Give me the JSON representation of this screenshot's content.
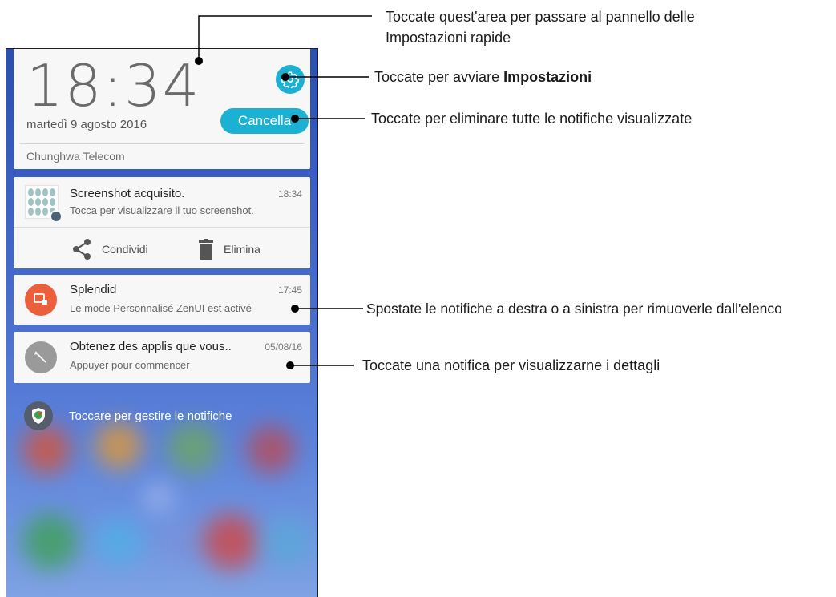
{
  "lock_header": {
    "time": "18:34",
    "date": "martedì 9 agosto 2016",
    "carrier": "Chunghwa Telecom",
    "clear_label": "Cancella",
    "settings_icon": "gear-icon"
  },
  "notifications": [
    {
      "title": "Screenshot acquisito.",
      "time": "18:34",
      "text": "Tocca per visualizzare il tuo screenshot.",
      "icon": "screenshot-thumbnail",
      "actions": [
        {
          "label": "Condividi",
          "icon": "share-icon"
        },
        {
          "label": "Elimina",
          "icon": "trash-icon"
        }
      ]
    },
    {
      "title": "Splendid",
      "time": "17:45",
      "text": "Le mode Personnalisé ZenUI est activé",
      "icon": "splendid-icon",
      "icon_color": "#eb5f3c"
    },
    {
      "title": "Obtenez des applis que vous..",
      "time": "05/08/16",
      "text": "Appuyer pour commencer",
      "icon": "magic-wand-icon",
      "icon_color": "#9a9a9a"
    }
  ],
  "manage_notifications": {
    "label": "Toccare per gestire le notifiche",
    "icon": "shield-icon"
  },
  "callouts": {
    "quick_settings_line1": "Toccate quest'area per passare al pannello delle",
    "quick_settings_line2": "Impostazioni rapide",
    "settings_prefix": "Toccate per avviare ",
    "settings_bold": "Impostazioni",
    "clear": "Toccate per eliminare tutte le notifiche visualizzate",
    "swipe": "Spostate le notifiche a destra o a sinistra per rimuoverle dall'elenco",
    "details": "Toccate una notifica per visualizzarne i dettagli"
  },
  "colors": {
    "accent": "#1cb1d2",
    "card_bg": "#f7f7f7",
    "wallpaper": "#3a5ec4"
  }
}
